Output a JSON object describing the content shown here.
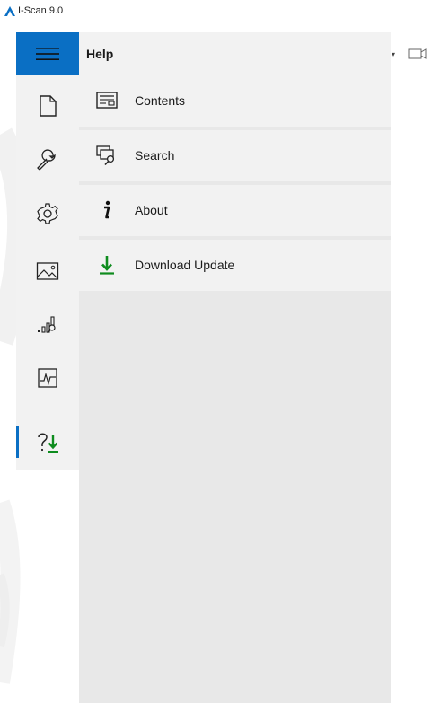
{
  "window": {
    "title": "I-Scan 9.0"
  },
  "toolbar": {
    "dropdown_glyph": "▾",
    "camera_icon": "video-camera-icon"
  },
  "rail": {
    "menu_icon": "hamburger-icon",
    "items": [
      {
        "icon": "new-file-icon"
      },
      {
        "icon": "wrench-icon"
      },
      {
        "icon": "gear-icon"
      },
      {
        "icon": "image-icon"
      },
      {
        "icon": "bar-analysis-icon"
      },
      {
        "icon": "graph-frame-icon"
      },
      {
        "icon": "help-download-icon",
        "active": true
      }
    ]
  },
  "panel": {
    "title": "Help",
    "items": [
      {
        "label": "Contents",
        "icon": "contents-icon"
      },
      {
        "label": "Search",
        "icon": "search-windows-icon"
      },
      {
        "label": "About",
        "icon": "info-icon"
      },
      {
        "label": "Download Update",
        "icon": "download-arrow-icon"
      }
    ]
  },
  "colors": {
    "accent": "#0a6fc4",
    "download_green": "#0e8c1e",
    "panel_bg": "#e8e8e8",
    "item_bg": "#f2f2f2"
  }
}
